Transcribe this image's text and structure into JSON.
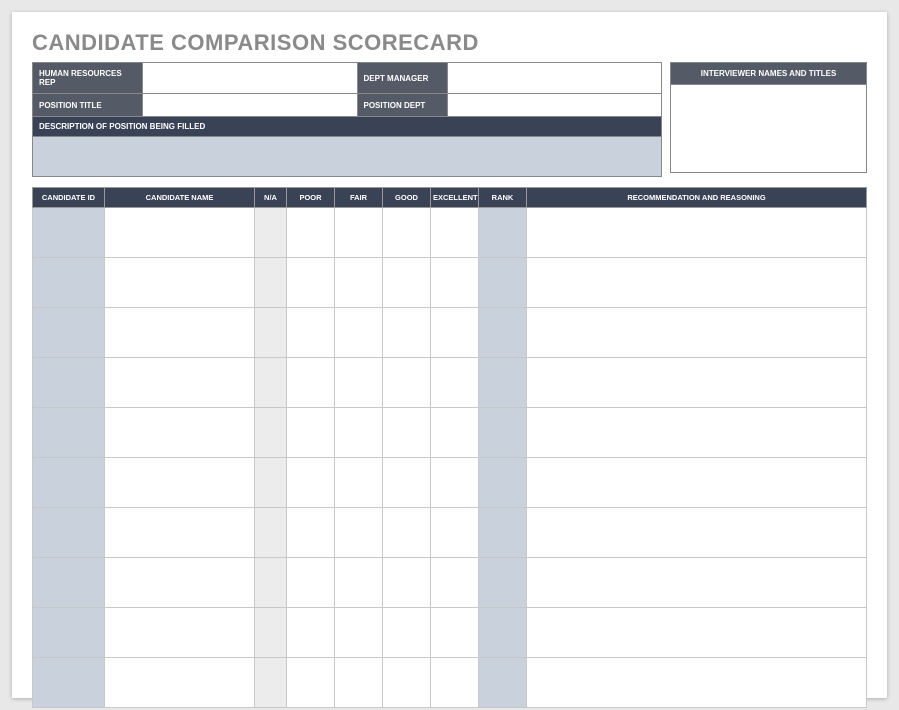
{
  "title": "CANDIDATE COMPARISON SCORECARD",
  "header": {
    "hr_rep_label": "HUMAN RESOURCES REP",
    "hr_rep_value": "",
    "dept_mgr_label": "DEPT MANAGER",
    "dept_mgr_value": "",
    "position_title_label": "POSITION TITLE",
    "position_title_value": "",
    "position_dept_label": "POSITION DEPT",
    "position_dept_value": "",
    "description_label": "DESCRIPTION OF POSITION BEING FILLED",
    "description_value": "",
    "interviewer_label": "INTERVIEWER NAMES AND TITLES",
    "interviewer_value": ""
  },
  "columns": {
    "candidate_id": "CANDIDATE ID",
    "candidate_name": "CANDIDATE NAME",
    "na": "N/A",
    "poor": "POOR",
    "fair": "FAIR",
    "good": "GOOD",
    "excellent": "EXCELLENT",
    "rank": "RANK",
    "recommendation": "RECOMMENDATION AND REASONING"
  },
  "rows": [
    {
      "id": "",
      "name": "",
      "na": "",
      "poor": "",
      "fair": "",
      "good": "",
      "excellent": "",
      "rank": "",
      "rec": ""
    },
    {
      "id": "",
      "name": "",
      "na": "",
      "poor": "",
      "fair": "",
      "good": "",
      "excellent": "",
      "rank": "",
      "rec": ""
    },
    {
      "id": "",
      "name": "",
      "na": "",
      "poor": "",
      "fair": "",
      "good": "",
      "excellent": "",
      "rank": "",
      "rec": ""
    },
    {
      "id": "",
      "name": "",
      "na": "",
      "poor": "",
      "fair": "",
      "good": "",
      "excellent": "",
      "rank": "",
      "rec": ""
    },
    {
      "id": "",
      "name": "",
      "na": "",
      "poor": "",
      "fair": "",
      "good": "",
      "excellent": "",
      "rank": "",
      "rec": ""
    },
    {
      "id": "",
      "name": "",
      "na": "",
      "poor": "",
      "fair": "",
      "good": "",
      "excellent": "",
      "rank": "",
      "rec": ""
    },
    {
      "id": "",
      "name": "",
      "na": "",
      "poor": "",
      "fair": "",
      "good": "",
      "excellent": "",
      "rank": "",
      "rec": ""
    },
    {
      "id": "",
      "name": "",
      "na": "",
      "poor": "",
      "fair": "",
      "good": "",
      "excellent": "",
      "rank": "",
      "rec": ""
    },
    {
      "id": "",
      "name": "",
      "na": "",
      "poor": "",
      "fair": "",
      "good": "",
      "excellent": "",
      "rank": "",
      "rec": ""
    },
    {
      "id": "",
      "name": "",
      "na": "",
      "poor": "",
      "fair": "",
      "good": "",
      "excellent": "",
      "rank": "",
      "rec": ""
    }
  ]
}
